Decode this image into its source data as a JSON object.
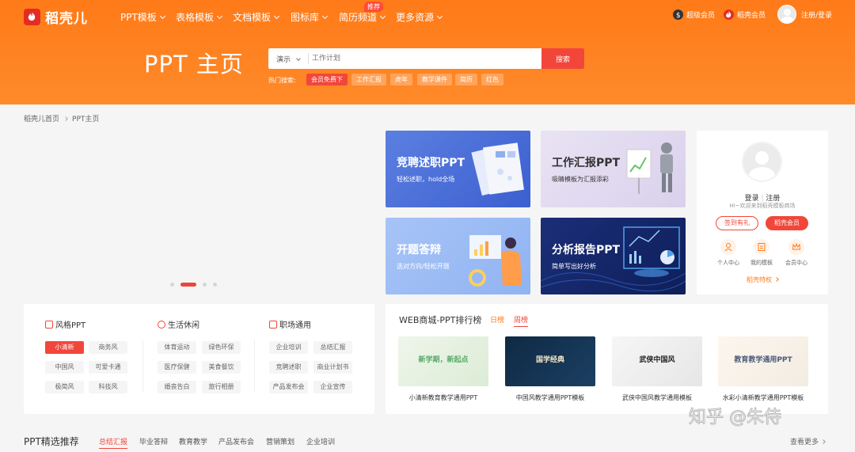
{
  "brand": {
    "logo_text": "稻壳儿",
    "accent": "#ff7a18",
    "red": "#f2463a"
  },
  "nav": {
    "items": [
      "PPT模板",
      "表格模板",
      "文档模板",
      "图标库",
      "简历频道",
      "更多资源"
    ],
    "badge": "推荐",
    "super_vip": "超级会员",
    "daoke_vip": "稻壳会员",
    "login": "注册/登录"
  },
  "hero": {
    "title": "PPT 主页"
  },
  "search": {
    "type": "演示",
    "placeholder": "工作计划",
    "button": "搜索"
  },
  "hot": {
    "label": "热门搜索:",
    "tags": [
      "会员免费下",
      "工作汇报",
      "虎年",
      "教学课件",
      "简历",
      "红色"
    ]
  },
  "breadcrumb": [
    "稻壳儿首页",
    "PPT主页"
  ],
  "banners": [
    {
      "title": "竞聘述职PPT",
      "sub": "轻松述职，hold全场"
    },
    {
      "title": "工作汇报PPT",
      "sub": "吸睛模板为汇报添彩"
    },
    {
      "title": "开题答辩",
      "sub": "选对方向/轻松开题"
    },
    {
      "title": "分析报告PPT",
      "sub": "简单写出好分析"
    }
  ],
  "user_card": {
    "login": "登录",
    "register": "注册",
    "welcome": "Hi~欢迎来到稻壳模板商场",
    "checkin": "签到有礼",
    "vip": "稻壳会员",
    "links": [
      "个人中心",
      "我的模板",
      "会员中心"
    ],
    "privilege": "稻壳特权"
  },
  "categories": [
    {
      "title": "风格PPT",
      "tags": [
        "小清新",
        "商务风",
        "中国风",
        "可爱卡通",
        "极简风",
        "科技风"
      ]
    },
    {
      "title": "生活休闲",
      "tags": [
        "体育运动",
        "绿色环保",
        "医疗保健",
        "美食餐饮",
        "婚丧告白",
        "旅行相册"
      ]
    },
    {
      "title": "职场通用",
      "tags": [
        "企业培训",
        "总结汇报",
        "竞聘述职",
        "商业计划书",
        "产品发布会",
        "企业宣传"
      ]
    }
  ],
  "ranking": {
    "title": "WEB商城-PPT排行榜",
    "tabs": [
      "日榜",
      "周榜"
    ],
    "items": [
      {
        "thumb_text": "新学期，新起点",
        "caption": "小清新教育教学通用PPT"
      },
      {
        "thumb_text": "国学经典",
        "caption": "中国风教学通用PPT模板"
      },
      {
        "thumb_text": "武侠中国风",
        "caption": "武侠中国风教学通用模板"
      },
      {
        "thumb_text": "教育教学通用PPT",
        "caption": "水彩小清新教学通用PPT模板"
      }
    ]
  },
  "recommend": {
    "title": "PPT精选推荐",
    "tabs": [
      "总结汇报",
      "毕业答辩",
      "教育教学",
      "产品发布会",
      "营销策划",
      "企业培训"
    ],
    "more": "查看更多"
  },
  "watermark": "知乎 @朱侍"
}
